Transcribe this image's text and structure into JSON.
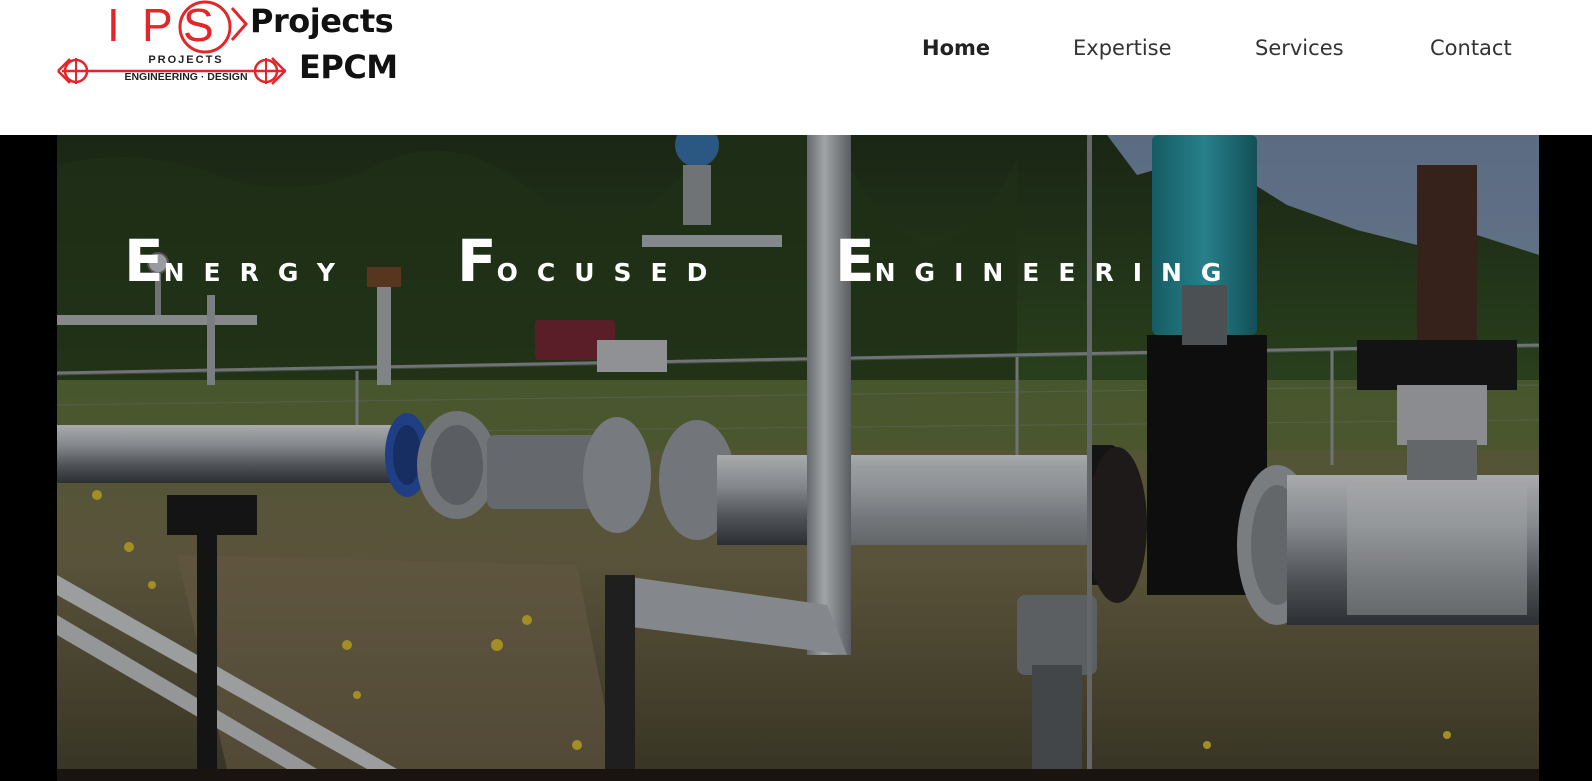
{
  "brand": {
    "logo_letters": [
      "I",
      "P",
      "S"
    ],
    "logo_sub1": "PROJECTS",
    "logo_sub2": "ENGINEERING · DESIGN",
    "wordmark_line1": "Projects",
    "wordmark_line2": "EPCM",
    "logo_color": "#e3262a"
  },
  "nav": {
    "items": [
      {
        "label": "Home",
        "active": true
      },
      {
        "label": "Expertise",
        "active": false
      },
      {
        "label": "Services",
        "active": false
      },
      {
        "label": "Contact",
        "active": false
      }
    ]
  },
  "hero": {
    "tagline_words": [
      {
        "cap": "E",
        "rest": "nergy"
      },
      {
        "cap": "F",
        "rest": "ocused"
      },
      {
        "cap": "E",
        "rest": "ngineering"
      }
    ],
    "image_subject": "industrial pipeline and valves at oil field site"
  },
  "colors": {
    "nav_text": "#333333",
    "hero_text": "#ffffff",
    "accent_teal": "#2aa3b0"
  }
}
